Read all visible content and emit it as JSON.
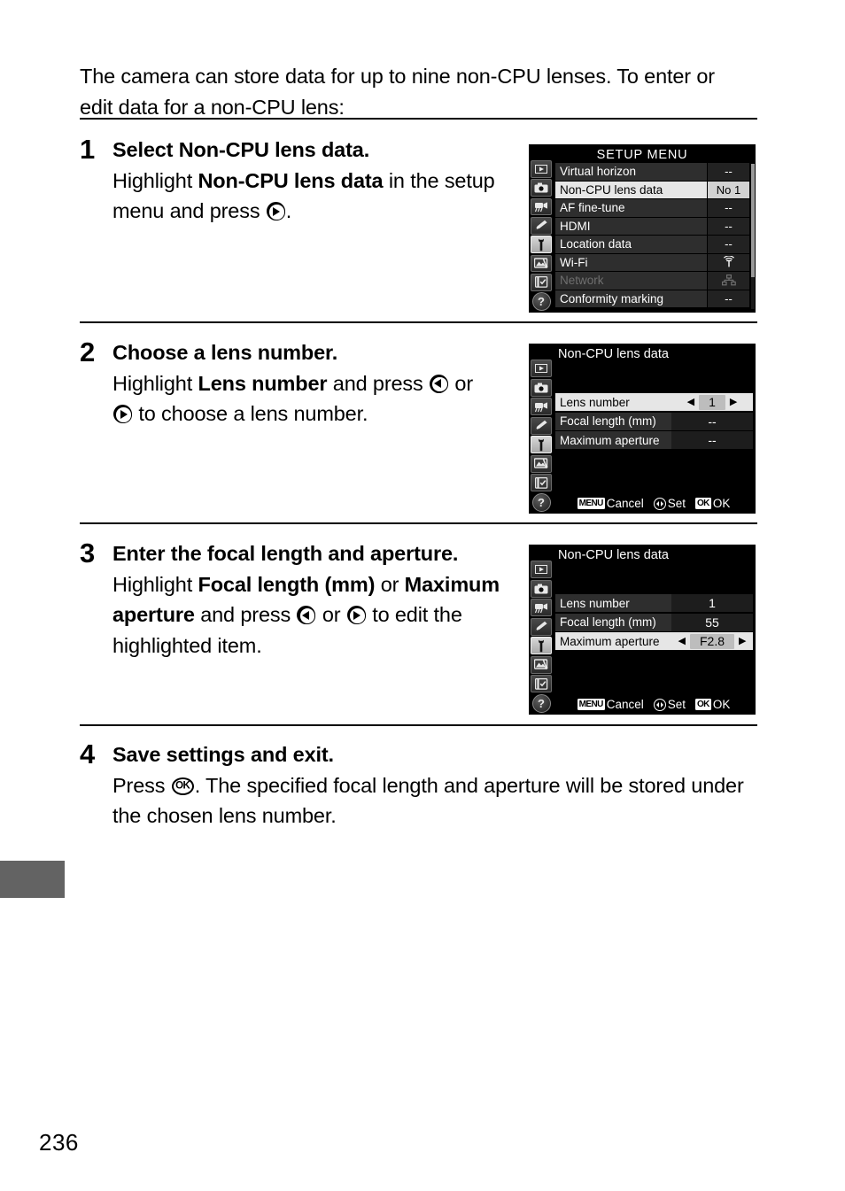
{
  "page": {
    "number": "236",
    "intro": "The camera can store data for up to nine non-CPU lenses.  To enter or edit data for a non-CPU lens:"
  },
  "steps": [
    {
      "number": "1",
      "heading_prefix": "Select ",
      "heading_bold": "Non-CPU lens data",
      "heading_suffix": ".",
      "body_1": "Highlight ",
      "body_bold_1": "Non-CPU lens data",
      "body_2": " in the setup menu and press ",
      "body_3": "."
    },
    {
      "number": "2",
      "heading": "Choose a lens number.",
      "body_1": "Highlight ",
      "body_bold_1": "Lens number",
      "body_2": " and press ",
      "body_3": " or ",
      "body_4": " to choose a lens number."
    },
    {
      "number": "3",
      "heading": "Enter the focal length and aperture.",
      "body_1": "Highlight ",
      "body_bold_1": "Focal length (mm)",
      "body_2": " or ",
      "body_bold_2": "Maximum aperture",
      "body_3": " and press ",
      "body_4": " or ",
      "body_5": " to edit the highlighted item."
    },
    {
      "number": "4",
      "heading": "Save settings and exit.",
      "body_1": "Press ",
      "body_ok": "OK",
      "body_2": ".  The specified focal length and aperture will be stored under the chosen lens number."
    }
  ],
  "screens": {
    "setup_menu": {
      "title": "SETUP MENU",
      "rail_icons": [
        "playback-icon",
        "shooting-camera-icon",
        "movie-camera-icon",
        "pencil-custom-settings-icon",
        "wrench-setup-icon",
        "retouch-icon",
        "recent-settings-icon",
        "help-question-icon"
      ],
      "rows": [
        {
          "label": "Virtual horizon",
          "value": "--",
          "state": "normal"
        },
        {
          "label": "Non-CPU lens data",
          "value": "No 1",
          "state": "highlighted"
        },
        {
          "label": "AF fine-tune",
          "value": "--",
          "state": "normal"
        },
        {
          "label": "HDMI",
          "value": "--",
          "state": "normal"
        },
        {
          "label": "Location data",
          "value": "--",
          "state": "normal"
        },
        {
          "label": "Wi-Fi",
          "value": "wifi-icon",
          "state": "normal"
        },
        {
          "label": "Network",
          "value": "network-icon",
          "state": "disabled"
        },
        {
          "label": "Conformity marking",
          "value": "--",
          "state": "normal"
        }
      ]
    },
    "lens_data_step2": {
      "title": "Non-CPU lens data",
      "rows": [
        {
          "label": "Lens number",
          "value": "1",
          "state": "highlighted",
          "arrows": true
        },
        {
          "label": "Focal length (mm)",
          "value": "--",
          "state": "normal",
          "arrows": false
        },
        {
          "label": "Maximum aperture",
          "value": "--",
          "state": "normal",
          "arrows": false
        }
      ],
      "helpbar": {
        "menu_key": "MENU",
        "cancel_label": "Cancel",
        "set_label": "Set",
        "ok_key": "OK",
        "ok_label": "OK"
      }
    },
    "lens_data_step3": {
      "title": "Non-CPU lens data",
      "rows": [
        {
          "label": "Lens number",
          "value": "1",
          "state": "normal",
          "arrows": false
        },
        {
          "label": "Focal length (mm)",
          "value": "55",
          "state": "normal",
          "arrows": false
        },
        {
          "label": "Maximum aperture",
          "value": "F2.8",
          "state": "highlighted",
          "arrows": true
        }
      ],
      "helpbar": {
        "menu_key": "MENU",
        "cancel_label": "Cancel",
        "set_label": "Set",
        "ok_key": "OK",
        "ok_label": "OK"
      }
    }
  },
  "colors": {
    "tab_marker": "#636363",
    "lcd_background": "#000000",
    "lcd_row": "#2e2e2e",
    "lcd_highlight": "#e6e6e6"
  }
}
